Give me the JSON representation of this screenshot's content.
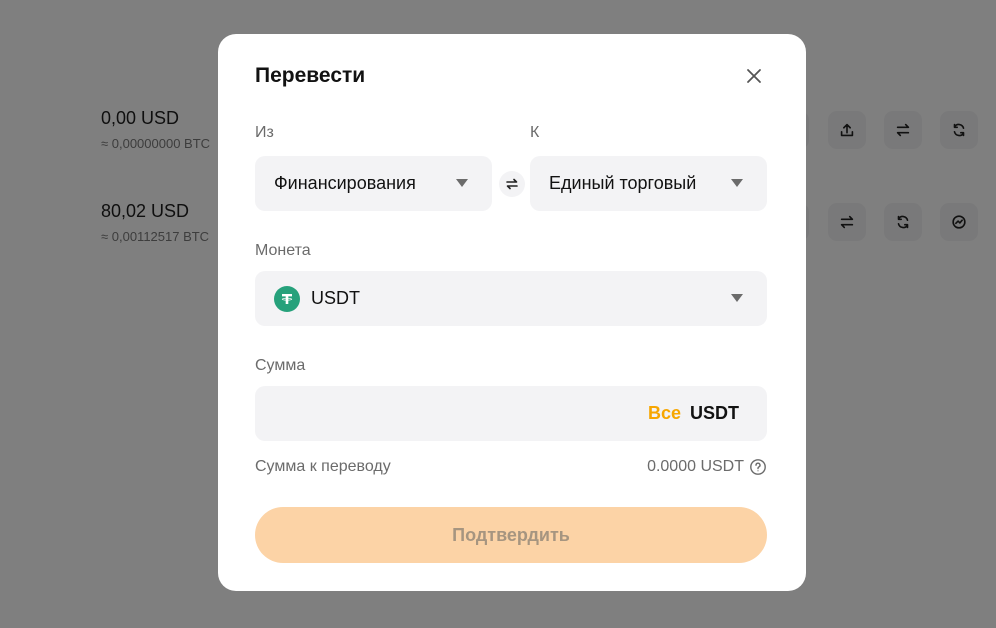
{
  "background": {
    "rows": [
      {
        "amount": "0,00 USD",
        "sub": "≈ 0,00000000 BTC"
      },
      {
        "amount": "80,02 USD",
        "sub": "≈ 0,00112517 BTC"
      }
    ]
  },
  "modal": {
    "title": "Перевести",
    "from_label": "Из",
    "to_label": "К",
    "from_value": "Финансирования",
    "to_value": "Единый торговый",
    "coin_label": "Монета",
    "coin_value": "USDT",
    "amount_label": "Сумма",
    "amount_value": "",
    "all_label": "Все",
    "amount_unit": "USDT",
    "transfer_label": "Сумма к переводу",
    "transfer_value": "0.0000 USDT",
    "confirm_label": "Подтвердить"
  },
  "icons": {
    "close": "close-icon",
    "swap": "swap-icon",
    "caret": "chevron-down-icon",
    "coin": "usdt-icon",
    "help": "help-icon"
  },
  "colors": {
    "accent": "#f7a600",
    "confirm_disabled_bg": "#fcd3a6",
    "usdt": "#26a17b"
  }
}
